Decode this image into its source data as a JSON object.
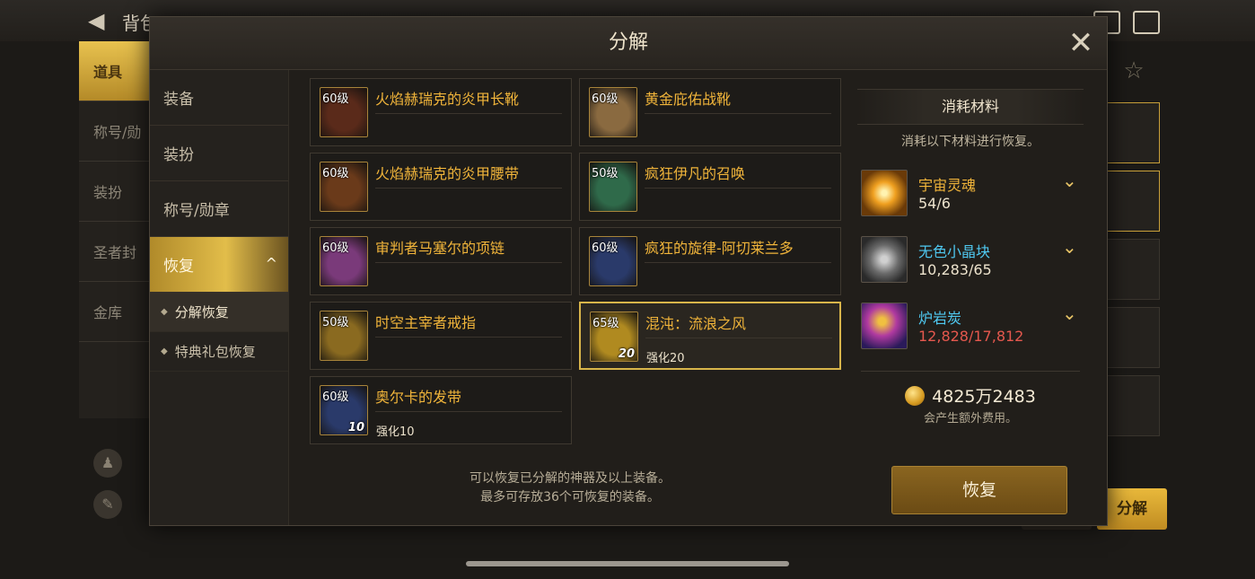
{
  "background": {
    "top_title": "背包",
    "side_tabs": [
      "道具",
      "称号/勋",
      "装扮",
      "圣者封",
      "金库"
    ],
    "button": "分解"
  },
  "dialog": {
    "title": "分解",
    "close": "✕"
  },
  "menu": {
    "items": [
      {
        "label": "装备"
      },
      {
        "label": "装扮"
      },
      {
        "label": "称号/勋章"
      },
      {
        "label": "恢复",
        "chevron": "^"
      }
    ],
    "subitems": [
      {
        "label": "分解恢复"
      },
      {
        "label": "特典礼包恢复"
      }
    ]
  },
  "items": [
    {
      "level": "60级",
      "name": "火焰赫瑞克的炎甲长靴",
      "enhance": "",
      "enhance_badge": "",
      "color": "#5a2a1a"
    },
    {
      "level": "60级",
      "name": "黄金庇佑战靴",
      "enhance": "",
      "enhance_badge": "",
      "color": "#8a6a40"
    },
    {
      "level": "60级",
      "name": "火焰赫瑞克的炎甲腰带",
      "enhance": "",
      "enhance_badge": "",
      "color": "#6a3a1a"
    },
    {
      "level": "50级",
      "name": "疯狂伊凡的召唤",
      "enhance": "",
      "enhance_badge": "",
      "color": "#2f6a4a"
    },
    {
      "level": "60级",
      "name": "审判者马塞尔的项链",
      "enhance": "",
      "enhance_badge": "",
      "color": "#7a3a7a"
    },
    {
      "level": "60级",
      "name": "疯狂的旋律-阿切莱兰多",
      "enhance": "",
      "enhance_badge": "",
      "color": "#2a3a6a"
    },
    {
      "level": "50级",
      "name": "时空主宰者戒指",
      "enhance": "",
      "enhance_badge": "",
      "color": "#8a6a20"
    },
    {
      "level": "65级",
      "name": "混沌：流浪之风",
      "enhance": "强化20",
      "enhance_badge": "20",
      "color": "#b08a20",
      "selected": true
    },
    {
      "level": "60级",
      "name": "奥尔卡的发带",
      "enhance": "强化10",
      "enhance_badge": "10",
      "color": "#2a3a6a"
    }
  ],
  "grid_note": [
    "可以恢复已分解的神器及以上装备。",
    "最多可存放36个可恢复的装备。"
  ],
  "materials_panel": {
    "title": "消耗材料",
    "desc": "消耗以下材料进行恢复。",
    "materials": [
      {
        "name": "宇宙灵魂",
        "count": "54/6",
        "name_color": "#f0b43a",
        "short": false,
        "icon_color": "#e0a020"
      },
      {
        "name": "无色小晶块",
        "count": "10,283/65",
        "name_color": "#4fc8f0",
        "short": false,
        "icon_color": "#7a7a7a"
      },
      {
        "name": "炉岩炭",
        "count": "12,828/17,812",
        "name_color": "#4fc8f0",
        "short": true,
        "icon_color": "#6a3aa0"
      }
    ],
    "chevron": "⌄",
    "gold": "4825万2483",
    "gold_note": "会产生额外费用。"
  },
  "restore_button": "恢复"
}
